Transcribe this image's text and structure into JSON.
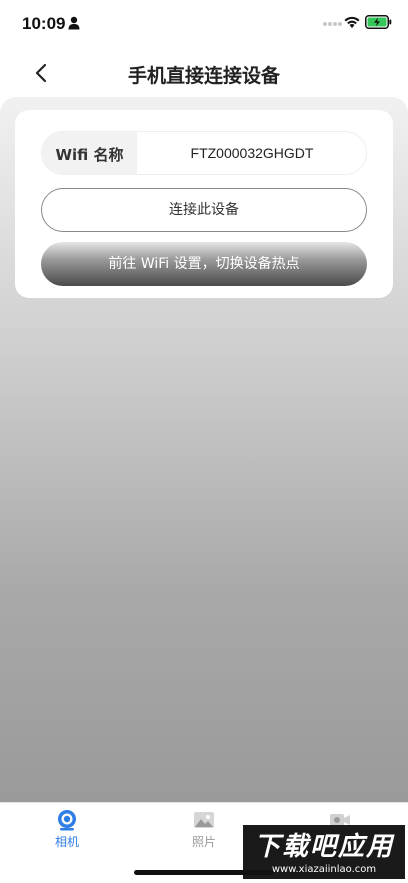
{
  "status_bar": {
    "time": "10:09"
  },
  "nav": {
    "title": "手机直接连接设备"
  },
  "wifi": {
    "label": "Wifi 名称",
    "value": "FTZ000032GHGDT"
  },
  "buttons": {
    "connect_label": "连接此设备",
    "wifi_settings_label": "前往 WiFi 设置，切换设备热点"
  },
  "tabs": [
    {
      "label": "相机",
      "icon": "camera-lens-icon",
      "active": true,
      "color": "#2f7ee6"
    },
    {
      "label": "照片",
      "icon": "photo-icon",
      "active": false,
      "color": "#999999"
    },
    {
      "label": "",
      "icon": "video-icon",
      "active": false,
      "color": "#999999"
    }
  ],
  "watermark": {
    "main": "下载吧应用",
    "sub": "www.xiazaiinlao.com"
  },
  "colors": {
    "accent": "#2f7ee6",
    "button_dark": "#4a4a4a"
  }
}
